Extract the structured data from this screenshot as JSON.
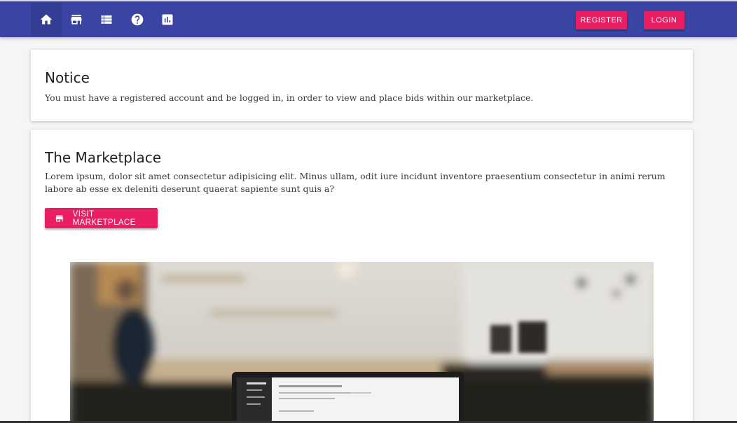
{
  "topbar": {
    "nav_icons": [
      "home-icon",
      "store-icon",
      "list-icon",
      "help-icon",
      "chart-icon"
    ],
    "register_label": "REGISTER",
    "login_label": "LOGIN",
    "colors": {
      "bar": "#3a45a3",
      "accent": "#e91e63"
    }
  },
  "notice": {
    "title": "Notice",
    "text": "You must have a registered account and be logged in, in order to view and place bids within our marketplace."
  },
  "marketplace": {
    "title": "The Marketplace",
    "text": "Lorem ipsum, dolor sit amet consectetur adipisicing elit. Minus ullam, odit iure incidunt inventore praesentium consectetur in animi rerum labore ab esse ex deleniti deserunt quaerat sapiente sunt quis a?",
    "button_label": "VISIT MARKETPLACE",
    "button_icon": "store-icon"
  }
}
